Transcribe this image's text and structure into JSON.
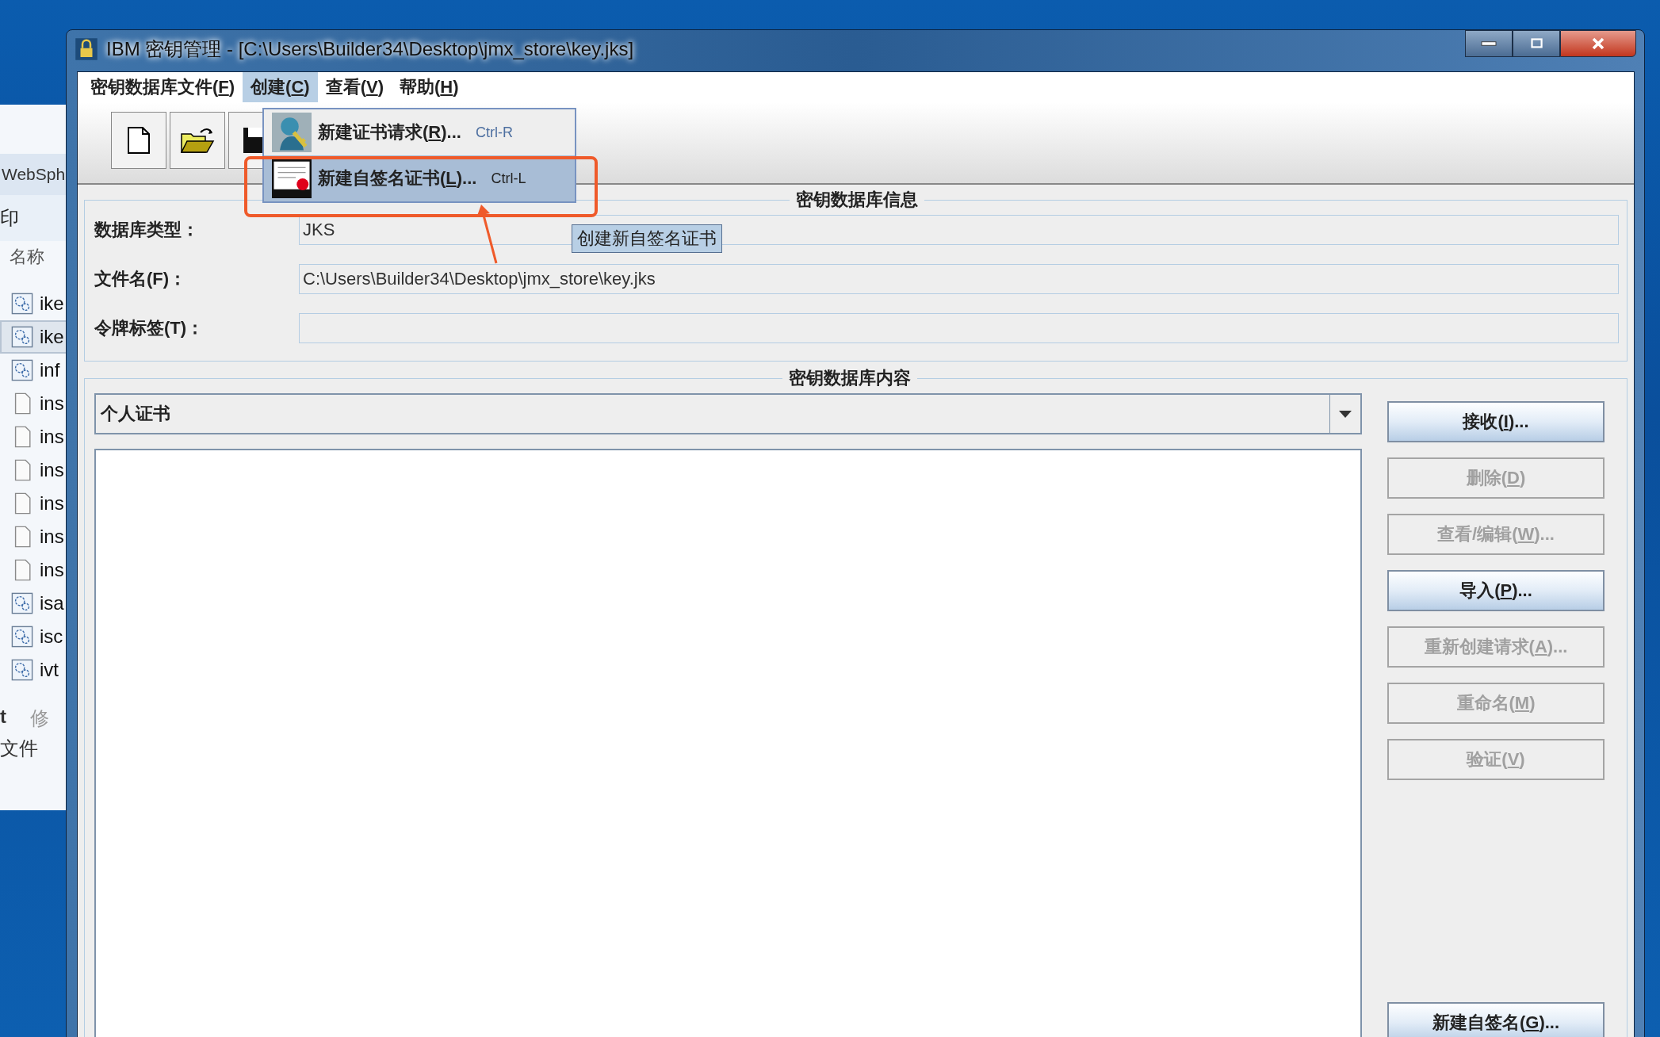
{
  "background_window": {
    "title": "WebSph",
    "toolbar_text": "印",
    "column_header": "名称",
    "files": [
      {
        "name": "ike",
        "kind": "config",
        "selected": false
      },
      {
        "name": "ike",
        "kind": "config",
        "selected": true
      },
      {
        "name": "inf",
        "kind": "config",
        "selected": false
      },
      {
        "name": "ins",
        "kind": "document",
        "selected": false
      },
      {
        "name": "ins",
        "kind": "document",
        "selected": false
      },
      {
        "name": "ins",
        "kind": "document",
        "selected": false
      },
      {
        "name": "ins",
        "kind": "document",
        "selected": false
      },
      {
        "name": "ins",
        "kind": "document",
        "selected": false
      },
      {
        "name": "ins",
        "kind": "document",
        "selected": false
      },
      {
        "name": "isa",
        "kind": "config",
        "selected": false
      },
      {
        "name": "isc",
        "kind": "config",
        "selected": false
      },
      {
        "name": "ivt",
        "kind": "config",
        "selected": false
      }
    ],
    "details": [
      "t",
      "修",
      "文件"
    ]
  },
  "window": {
    "title": "IBM 密钥管理 - [C:\\Users\\Builder34\\Desktop\\jmx_store\\key.jks]"
  },
  "menu_bar": [
    {
      "label": "密钥数据库文件(F)",
      "selected": false
    },
    {
      "label": "创建(C)",
      "selected": true
    },
    {
      "label": "查看(V)",
      "selected": false
    },
    {
      "label": "帮助(H)",
      "selected": false
    }
  ],
  "toolbar": [
    {
      "kind": "new"
    },
    {
      "kind": "open"
    },
    {
      "kind": "save"
    }
  ],
  "create_menu": [
    {
      "label": "新建证书请求(R)...",
      "shortcut": "Ctrl-R",
      "kind": "request",
      "selected": false
    },
    {
      "label": "新建自签名证书(L)...",
      "shortcut": "Ctrl-L",
      "kind": "certificate",
      "selected": true
    }
  ],
  "tooltip": "创建新自签名证书",
  "info_panel": {
    "title": "密钥数据库信息",
    "fields": [
      {
        "label": "数据库类型：",
        "value": "JKS"
      },
      {
        "label": "文件名(F)：",
        "value": "C:\\Users\\Builder34\\Desktop\\jmx_store\\key.jks"
      },
      {
        "label": "令牌标签(T)："
      }
    ]
  },
  "contents_panel": {
    "title": "密钥数据库内容",
    "selector": {
      "value": "个人证书"
    },
    "buttons": [
      {
        "label": "接收(I)...",
        "disabled": false
      },
      {
        "label": "删除(D)",
        "disabled": true
      },
      {
        "label": "查看/编辑(W)...",
        "disabled": true
      },
      {
        "label": "导入(P)...",
        "disabled": false
      },
      {
        "label": "重新创建请求(A)...",
        "disabled": true
      },
      {
        "label": "重命名(M)",
        "disabled": true
      },
      {
        "label": "验证(V)",
        "disabled": true
      }
    ],
    "bottom_button": {
      "label": "新建自签名(G)...",
      "disabled": false
    }
  }
}
